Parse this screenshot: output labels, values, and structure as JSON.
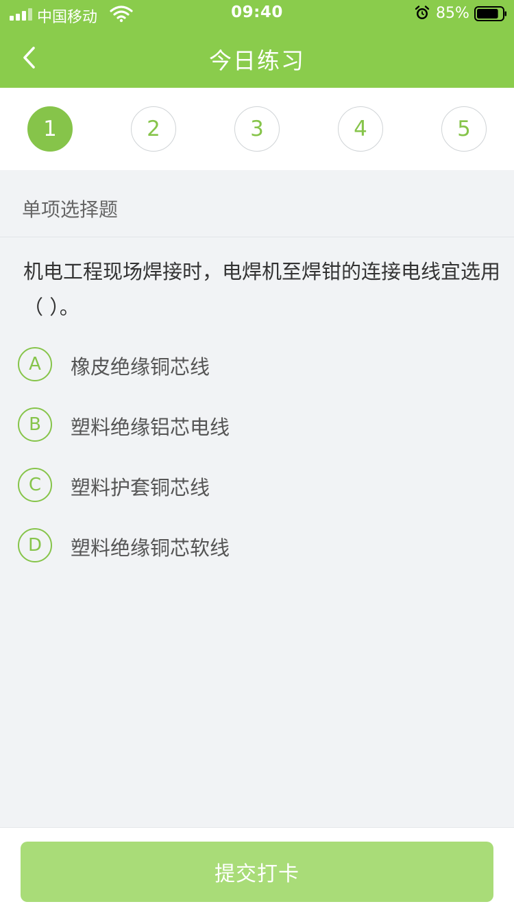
{
  "status_bar": {
    "carrier": "中国移动",
    "time": "09:40",
    "battery_percent": "85%",
    "battery_level": 0.85,
    "icons": [
      "signal-icon",
      "wifi-icon",
      "alarm-icon",
      "battery-icon"
    ]
  },
  "nav": {
    "title": "今日练习",
    "back_icon": "chevron-left-icon"
  },
  "steps": {
    "items": [
      "1",
      "2",
      "3",
      "4",
      "5"
    ],
    "active": "1"
  },
  "section": {
    "title": "单项选择题"
  },
  "question": {
    "text": "机电工程现场焊接时，电焊机至焊钳的连接电线宜选用（    ）。"
  },
  "options": [
    {
      "key": "A",
      "text": "橡皮绝缘铜芯线"
    },
    {
      "key": "B",
      "text": "塑料绝缘铝芯电线"
    },
    {
      "key": "C",
      "text": "塑料护套铜芯线"
    },
    {
      "key": "D",
      "text": "塑料绝缘铜芯软线"
    }
  ],
  "submit": {
    "label": "提交打卡"
  },
  "colors": {
    "brand_green": "#8acc4c",
    "accent_green": "#86c44a",
    "submit_disabled": "#a9dc78",
    "background": "#f1f3f5"
  }
}
